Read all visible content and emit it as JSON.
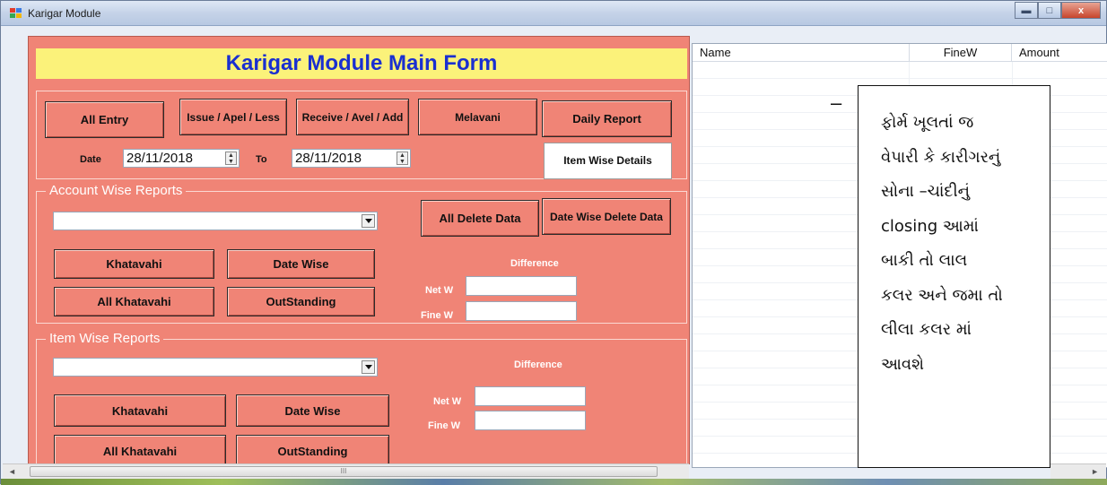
{
  "window": {
    "title": "Karigar Module",
    "controls": {
      "minimize": "▬",
      "maximize": "□",
      "close": "x"
    }
  },
  "form": {
    "heading": "Karigar Module Main Form",
    "top_buttons": {
      "all_entry": "All Entry",
      "issue": "Issue / Apel / Less",
      "receive": "Receive / Avel / Add",
      "melavani": "Melavani",
      "daily_report": "Daily Report",
      "item_wise_details": "Item Wise Details"
    },
    "date_filter": {
      "date_label": "Date",
      "from_value": "28/11/2018",
      "to_label": "To",
      "to_value": "28/11/2018"
    }
  },
  "account_wise": {
    "legend": "Account Wise Reports",
    "combo_value": "",
    "buttons": {
      "all_delete": "All Delete Data",
      "date_wise_delete": "Date Wise Delete Data",
      "khatavahi": "Khatavahi",
      "date_wise": "Date Wise",
      "all_khatavahi": "All Khatavahi",
      "outstanding": "OutStanding"
    },
    "difference_label": "Difference",
    "net_w_label": "Net W",
    "fine_w_label": "Fine W",
    "net_w_value": "",
    "fine_w_value": ""
  },
  "item_wise": {
    "legend": "Item Wise Reports",
    "combo_value": "",
    "buttons": {
      "khatavahi": "Khatavahi",
      "date_wise": "Date Wise",
      "all_khatavahi": "All Khatavahi",
      "outstanding": "OutStanding"
    },
    "difference_label": "Difference",
    "net_w_label": "Net W",
    "fine_w_label": "Fine W",
    "net_w_value": "",
    "fine_w_value": ""
  },
  "grid": {
    "columns": [
      "Name",
      "FineW",
      "Amount"
    ]
  },
  "note": {
    "dash": "–",
    "lines": [
      "ફોર્મ ખૂલતાં જ",
      "વેપારી કે કારીગરનું",
      "સોના –ચાંદીનું",
      "closing આમાં",
      "બાકી તો લાલ",
      "કલર અને જમા તો",
      "લીલા કલર  માં",
      "આવશે"
    ]
  },
  "scrollbar": {
    "left_arrow": "◄",
    "right_arrow": "►",
    "grip": "III"
  }
}
